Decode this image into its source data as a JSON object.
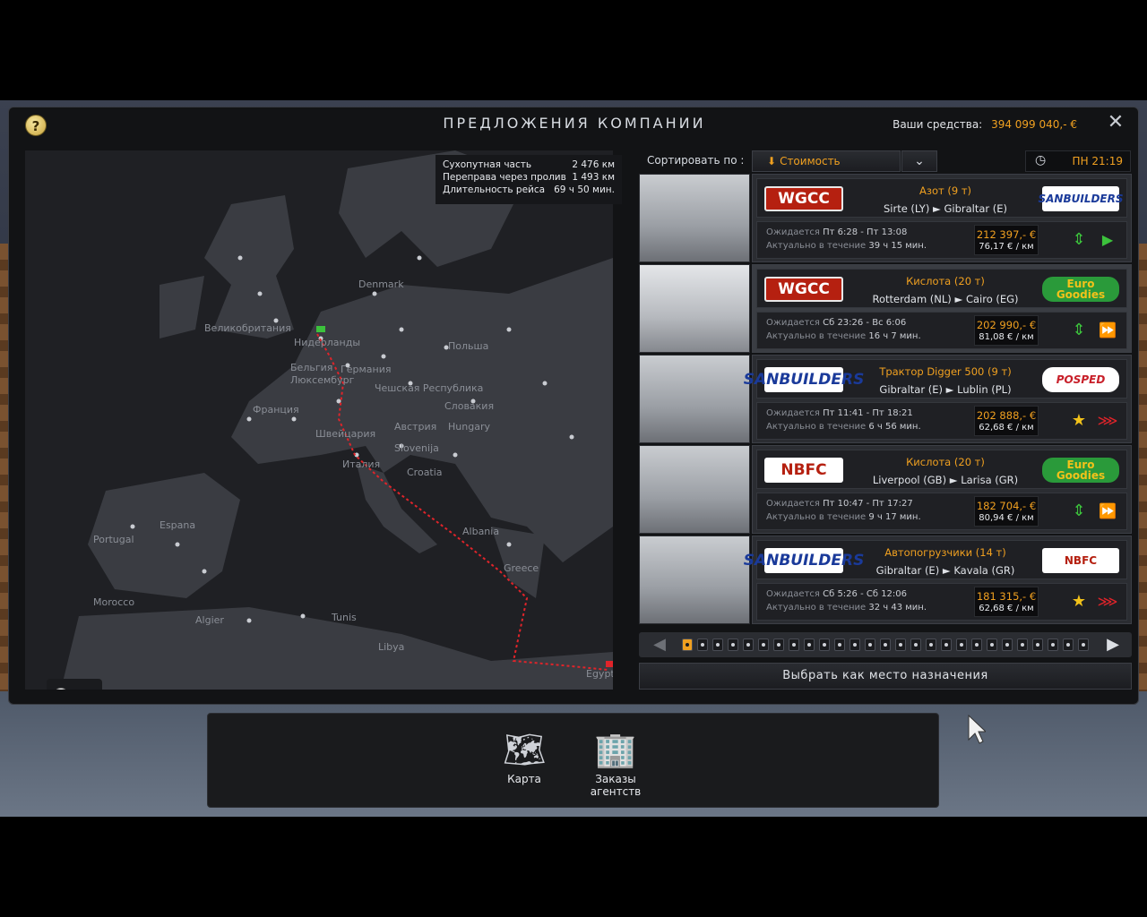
{
  "window": {
    "title": "ПРЕДЛОЖЕНИЯ КОМПАНИИ",
    "help_label": "?",
    "close_label": "✕",
    "funds_label": "Ваши средства:",
    "funds_value": "394 099 040,- €"
  },
  "route_info": [
    {
      "label": "Сухопутная часть",
      "value": "2 476 км"
    },
    {
      "label": "Переправа через пролив",
      "value": "1 493 км"
    },
    {
      "label": "Длительность рейса",
      "value": "69 ч 50 мин."
    }
  ],
  "map_labels": [
    "Denmark",
    "Великобритания",
    "Нидерланды",
    "Польша",
    "Бельгия",
    "Германия",
    "Люксембург",
    "Чешская Республика",
    "Франция",
    "Словакия",
    "Швейцария",
    "Австрия",
    "Hungary",
    "Slovenija",
    "Италия",
    "Croatia",
    "Espana",
    "Portugal",
    "Albania",
    "Greece",
    "Morocco",
    "Algier",
    "Tunis",
    "Libya",
    "Egypt"
  ],
  "sort": {
    "label": "Сортировать по :",
    "selected": "Стоимость",
    "dropdown_icon": "chevron-down-icon"
  },
  "clock": {
    "time": "ПН 21:19"
  },
  "jobs": [
    {
      "cargo": "Азот (9 т)",
      "route": "Sirte (LY) ► Gibraltar (E)",
      "from_company": "WGCC",
      "to_company": "SANBUILDERS",
      "expected_label": "Ожидается",
      "expected": "Пт 6:28 - Пт 13:08",
      "valid_label": "Актуально в течение",
      "valid": "39 ч 15 мин.",
      "price": "212 397,- €",
      "per_km": "76,17 € / км",
      "action2": "play-icon"
    },
    {
      "cargo": "Кислота (20 т)",
      "route": "Rotterdam (NL) ► Cairo (EG)",
      "from_company": "WGCC",
      "to_company": "Euro Goodies",
      "expected_label": "Ожидается",
      "expected": "Сб 23:26 - Вс 6:06",
      "valid_label": "Актуально в течение",
      "valid": "16 ч 7 мин.",
      "price": "202 990,- €",
      "per_km": "81,08 € / км",
      "action2": "fast-forward-icon"
    },
    {
      "cargo": "Трактор Digger 500 (9 т)",
      "route": "Gibraltar (E) ► Lublin (PL)",
      "from_company": "SANBUILDERS",
      "to_company": "POSPED",
      "expected_label": "Ожидается",
      "expected": "Пт 11:41 - Пт 18:21",
      "valid_label": "Актуально в течение",
      "valid": "6 ч 56 мин.",
      "price": "202 888,- €",
      "per_km": "62,68 € / км",
      "action2": "triple-arrow-icon"
    },
    {
      "cargo": "Кислота (20 т)",
      "route": "Liverpool (GB) ► Larisa (GR)",
      "from_company": "NBFC",
      "to_company": "Euro Goodies",
      "expected_label": "Ожидается",
      "expected": "Пт 10:47 - Пт 17:27",
      "valid_label": "Актуально в течение",
      "valid": "9 ч 17 мин.",
      "price": "182 704,- €",
      "per_km": "80,94 € / км",
      "action2": "fast-forward-icon"
    },
    {
      "cargo": "Автопогрузчики (14 т)",
      "route": "Gibraltar (E) ► Kavala (GR)",
      "from_company": "SANBUILDERS",
      "to_company": "NBFC",
      "expected_label": "Ожидается",
      "expected": "Сб 5:26 - Сб 12:06",
      "valid_label": "Актуально в течение",
      "valid": "32 ч 43 мин.",
      "price": "181 315,- €",
      "per_km": "62,68 € / км",
      "action2": "triple-arrow-icon"
    }
  ],
  "pager": {
    "pages": 27,
    "current": 1
  },
  "select_destination": "Выбрать как место назначения",
  "dock": {
    "map_label": "Карта",
    "agency_label": "Заказы агентств"
  }
}
